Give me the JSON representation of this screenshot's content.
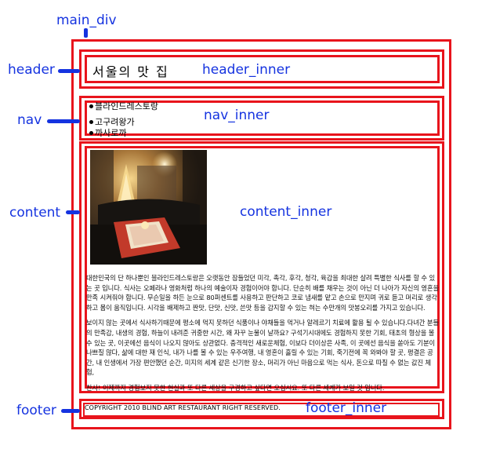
{
  "labels": {
    "main_div": "main_div",
    "header": "header",
    "header_inner": "header_inner",
    "nav": "nav",
    "nav_inner": "nav_inner",
    "content": "content",
    "content_inner": "content_inner",
    "footer": "footer",
    "footer_inner": "footer_inner"
  },
  "header": {
    "title": "서울의 맛 집"
  },
  "nav": {
    "items": [
      "블라인드레스토랑",
      "고구려왕가",
      "까사로까"
    ]
  },
  "content": {
    "paragraphs": [
      "대한민국의 단 하나뿐인 블라인드레스토랑은 오랫동안 잠들었던 미각, 촉각, 후각, 청각, 육감을 최대한 살려 특별한 식사를 할 수 있는 곳 입니다. 식사는 오페라나 영화처럼 하나의 예술이자 경험이어야 합니다. 단순히 배를 채우는 것이 아닌 더 나아가 자신의 영혼을 만족 시켜줘야 합니다. 무슨일을 하든 눈으로 80퍼센트를 사용하고 판단하고 코로 냄새를 맡고 손으로 만지며 귀로 듣고 머리로 생각하고 몸이 움직입니다. 시각을 배제하고 짠맛, 단맛, 신맛, 쓴맛 등을 감지할 수 있는 혀는 수만개의 맛봉오리를 가지고 있습니다.",
      "보이지 않는 곳에서 식사하기때문에 평소에 먹지 못하던 식품이나 야채들을 먹거나 알레르기 치료에 활용 될 수 있습니다.다녀간 분들의 만족감, 내생의 경험, 하늘이 내려준 귀중한 시간, 왜 자꾸 눈물이 날까요? 구석기시대에도 경험하지 못한 기회, 태초의 형상을 볼 수 있는 곳, 이곳에선 음식이 나오지 않아도 상관없다. 충격적인 새로운체험, 이보다 더이상은 사족, 이 곳에선 음식을 쏟아도 기분이 나쁘질 않다, 삶에 대한 재 인식, 내가 나를 볼 수 있는 우주여행, 내 영혼이 흘릴 수 있는 기회, 죽기전에 꼭 와봐야 할 곳, 평결은 공간, 내 인생에서 가장 편안했던 순간, 미지의 세계 같은 신기한 장소, 머리가 아닌 마음으로 먹는 식사, 돈으로 따질 수 없는 값진 체험,",
      "찬사! 이제까지 경험보지 못한 현실과 또 다른 세상을 구경하고 싶다면 오십시요. 또 다른 세계가 보일 것 입니다."
    ],
    "photo_description": "레스토랑 내부 사진"
  },
  "footer": {
    "text": "COPYRIGHT  2010  BLIND ART RESTAURANT RIGHT RESERVED."
  },
  "colors": {
    "box_border": "#e8141c",
    "callout": "#1533e0"
  }
}
